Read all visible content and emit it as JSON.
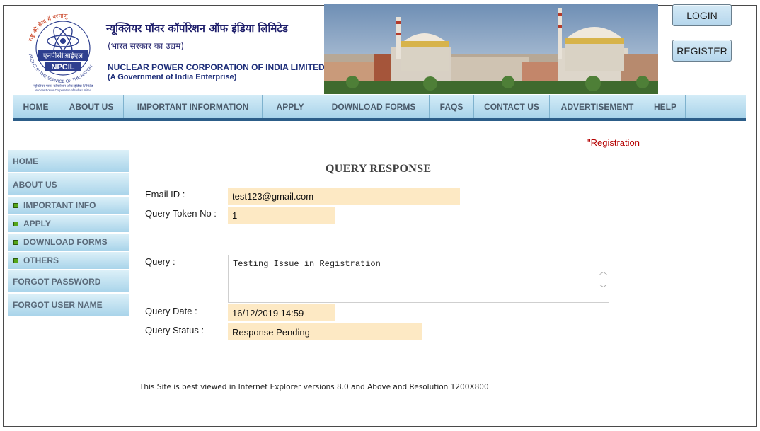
{
  "header": {
    "org_name_hindi": "न्यूक्लियर पॉवर कॉर्पोरेशन ऑफ इंडिया लिमिटेड",
    "org_sub_hindi": "(भारत सरकार का उद्यम)",
    "org_name_en": "NUCLEAR POWER CORPORATION OF INDIA LIMITED",
    "org_sub_en": "(A Government of India Enterprise)",
    "logo": {
      "top_arc": "राष्ट्र की सेवा में परमाणु",
      "hindi_abbr": "एनपीसीआईएल",
      "abbr": "NPCIL",
      "bottom_arc": "ATOMS IN THE SERVICE OF THE NATION",
      "caption_hindi": "न्यूक्लियर पावर कॉर्पोरेशन ऑफ इंडिया लिमिटेड",
      "caption_en": "Nuclear Power Corporation of India Limited"
    },
    "login_label": "LOGIN",
    "register_label": "REGISTER"
  },
  "nav": [
    {
      "label": "HOME"
    },
    {
      "label": "ABOUT US"
    },
    {
      "label": "IMPORTANT INFORMATION"
    },
    {
      "label": "APPLY"
    },
    {
      "label": "DOWNLOAD FORMS"
    },
    {
      "label": "FAQS"
    },
    {
      "label": "CONTACT US"
    },
    {
      "label": "ADVERTISEMENT"
    },
    {
      "label": "HELP"
    }
  ],
  "marquee_text": "\"Registration",
  "sidebar": [
    {
      "label": "HOME"
    },
    {
      "label": "ABOUT US"
    },
    {
      "label": "IMPORTANT INFO"
    },
    {
      "label": "APPLY"
    },
    {
      "label": "DOWNLOAD FORMS"
    },
    {
      "label": "OTHERS"
    },
    {
      "label": "FORGOT PASSWORD"
    },
    {
      "label": "FORGOT USER NAME"
    }
  ],
  "main": {
    "title": "QUERY RESPONSE",
    "email_label": "Email ID :",
    "email_value": "test123@gmail.com",
    "token_label": "Query Token No :",
    "token_value": "1",
    "query_label": "Query :",
    "query_value": "Testing Issue in Registration",
    "date_label": "Query Date :",
    "date_value": "16/12/2019 14:59",
    "status_label": "Query Status :",
    "status_value": "Response Pending"
  },
  "footer": "This Site is best viewed in Internet Explorer versions 8.0 and Above and Resolution 1200X800",
  "colors": {
    "nav_gradient_top": "#d4ecf7",
    "nav_gradient_bottom": "#a8d3ea",
    "nav_underline": "#2c5d88",
    "field_bg": "#fde9c4",
    "marquee": "#b50000",
    "bullet": "#55a61a"
  }
}
